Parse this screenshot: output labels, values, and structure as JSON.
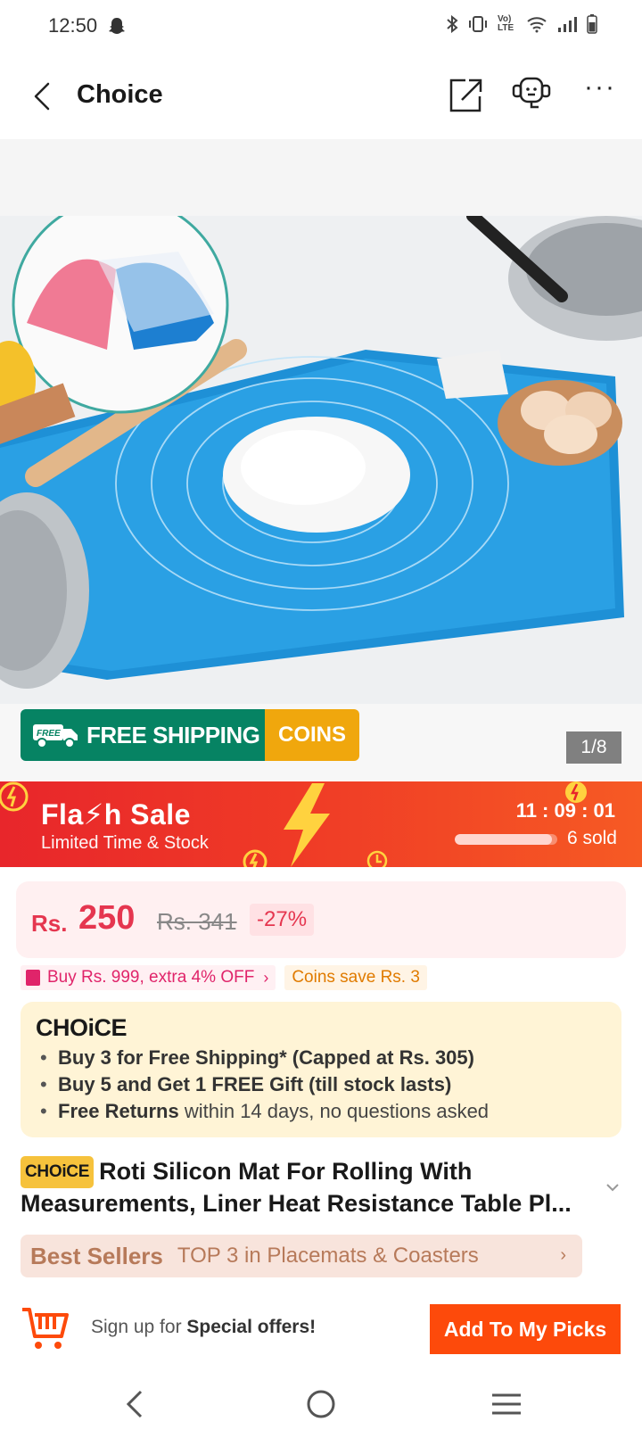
{
  "status_bar": {
    "time": "12:50",
    "icons": [
      "snapchat-ghost-icon",
      "bluetooth-icon",
      "vibrate-icon",
      "volte-icon",
      "wifi-icon",
      "signal-icon",
      "battery-icon"
    ],
    "volte_label": "Vo) LTE"
  },
  "header": {
    "title": "Choice",
    "more_label": "···"
  },
  "gallery": {
    "counter": "1/8"
  },
  "shipping_banner": {
    "truck_tag": "FREE",
    "free_shipping": "FREE SHIPPING",
    "coins": "COINS"
  },
  "flash_sale": {
    "title": "Fla⚡h Sale",
    "subtitle": "Limited Time & Stock",
    "timer": "11 : 09 : 01",
    "sold": "6 sold",
    "sold_progress": 0.95
  },
  "price": {
    "currency": "Rs.",
    "value": "250",
    "original": "Rs. 341",
    "discount": "-27%"
  },
  "promos": {
    "extra_off": "Buy Rs. 999, extra 4% OFF",
    "chevron": "›",
    "coins_save": "Coins save Rs. 3"
  },
  "choice_box": {
    "logo": "CHOiCE",
    "item1_bold": "Buy 3 for  Free Shipping* (Capped at Rs. 305)",
    "item2_bold": "Buy 5 and Get 1 FREE Gift (till stock lasts)",
    "item3_bold": "Free Returns",
    "item3_rest": " within 14 days, no questions asked"
  },
  "product": {
    "badge": "CHOiCE",
    "title": "Roti Silicon Mat For Rolling With Measurements, Liner Heat Resistance Table Pl..."
  },
  "best_sellers": {
    "label": "Best Sellers",
    "text": "TOP 3 in Placemats & Coasters",
    "chevron": "›"
  },
  "bottom_bar": {
    "signup_prefix": "Sign up for ",
    "signup_bold": "Special offers!",
    "picks_button": "Add To My Picks"
  },
  "colors": {
    "accent": "#fd4a0b",
    "price": "#e5364f",
    "shipping_green": "#068363",
    "coins_orange": "#f0a70d",
    "choice_yellow": "#f6c23c"
  }
}
